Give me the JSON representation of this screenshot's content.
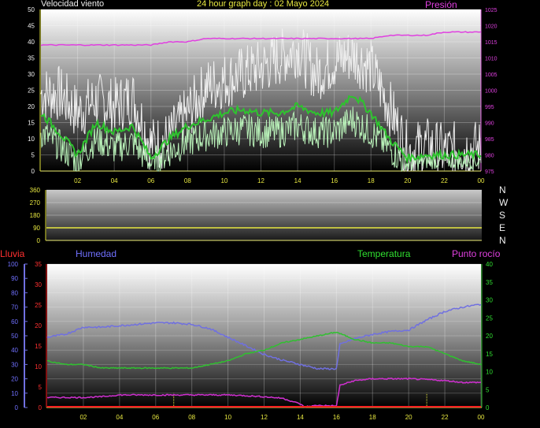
{
  "header": {
    "wind_label": "Velocidad viento",
    "title": "24 hour graph day : 02 Mayo 2024",
    "pressure_label": "Presión"
  },
  "labels": {
    "rain": "Lluvia",
    "humidity": "Humedad",
    "temperature": "Temperatura",
    "dewpoint": "Punto rocío"
  },
  "compass": [
    "N",
    "W",
    "S",
    "E",
    "N"
  ],
  "colors": {
    "wind_gust": "#f0f0f0",
    "wind_avg": "#2ec42e",
    "wind_speed": "#b8f0b8",
    "pressure": "#e040e0",
    "direction": "#e8e840",
    "humidity": "#7070e0",
    "temperature": "#30c030",
    "dewpoint": "#d030d0",
    "rain": "#ff2020",
    "axis_tick": "#e8e840",
    "title": "#e8e840",
    "humidity_label": "#7070ff",
    "temp_label": "#30e030",
    "rain_label": "#ff3030",
    "pressure_label": "#e040e0"
  },
  "chart_data": [
    {
      "type": "line",
      "name": "wind",
      "x_ticks": [
        "02",
        "04",
        "06",
        "08",
        "10",
        "12",
        "14",
        "16",
        "18",
        "20",
        "22",
        "00"
      ],
      "y_ticks_left": [
        0,
        5,
        10,
        15,
        20,
        25,
        30,
        35,
        40,
        45,
        50
      ],
      "y_ticks_right": [
        975,
        980,
        985,
        990,
        995,
        1000,
        1005,
        1010,
        1015,
        1020,
        1025
      ],
      "ylim_left": [
        0,
        50
      ],
      "ylim_right": [
        975,
        1025
      ],
      "xlim_hours": [
        0,
        24
      ],
      "series": [
        {
          "name": "Velocidad viento",
          "role": "gust",
          "x": [
            0,
            1,
            2,
            3,
            4,
            5,
            6,
            7,
            8,
            9,
            10,
            11,
            12,
            13,
            14,
            15,
            16,
            17,
            18,
            19,
            20,
            21,
            22,
            23,
            24
          ],
          "values": [
            24,
            24,
            18,
            22,
            20,
            23,
            8,
            10,
            18,
            26,
            28,
            30,
            32,
            35,
            38,
            30,
            34,
            36,
            32,
            20,
            6,
            8,
            6,
            7,
            7
          ]
        },
        {
          "name": "Velocidad viento",
          "role": "average",
          "x": [
            0,
            1,
            2,
            3,
            4,
            5,
            6,
            7,
            8,
            9,
            10,
            11,
            12,
            13,
            14,
            15,
            16,
            17,
            18,
            19,
            20,
            21,
            22,
            23,
            24
          ],
          "values": [
            18,
            12,
            5,
            15,
            12,
            14,
            4,
            10,
            14,
            16,
            18,
            19,
            18,
            18,
            20,
            18,
            18,
            24,
            18,
            10,
            4,
            5,
            5,
            5,
            5
          ]
        },
        {
          "name": "Velocidad viento",
          "role": "speed",
          "x": [
            0,
            1,
            2,
            3,
            4,
            5,
            6,
            7,
            8,
            9,
            10,
            11,
            12,
            13,
            14,
            15,
            16,
            17,
            18,
            19,
            20,
            21,
            22,
            23,
            24
          ],
          "values": [
            12,
            8,
            3,
            10,
            7,
            9,
            2,
            6,
            9,
            11,
            12,
            13,
            12,
            12,
            14,
            12,
            12,
            16,
            12,
            7,
            2,
            3,
            3,
            3,
            3
          ]
        },
        {
          "name": "Presión",
          "axis": "right",
          "x": [
            0,
            1,
            2,
            3,
            4,
            5,
            6,
            7,
            8,
            9,
            10,
            11,
            12,
            13,
            14,
            15,
            16,
            17,
            18,
            19,
            20,
            21,
            22,
            23,
            24
          ],
          "values": [
            1014,
            1014,
            1014,
            1014,
            1014,
            1014,
            1014,
            1015,
            1015,
            1016,
            1016,
            1016,
            1016,
            1016,
            1016,
            1016,
            1016,
            1016,
            1016,
            1017,
            1017,
            1017,
            1018,
            1018,
            1018
          ]
        }
      ]
    },
    {
      "type": "line",
      "name": "wind-direction",
      "y_ticks": [
        0,
        90,
        180,
        270,
        360
      ],
      "ylim": [
        0,
        360
      ],
      "xlim_hours": [
        0,
        24
      ],
      "series": [
        {
          "role": "direction",
          "x": [
            0,
            24
          ],
          "values": [
            90,
            90
          ]
        }
      ]
    },
    {
      "type": "line",
      "name": "humidity-temp",
      "x_ticks": [
        "02",
        "04",
        "06",
        "08",
        "10",
        "12",
        "14",
        "16",
        "18",
        "20",
        "22",
        "00"
      ],
      "y_ticks_humidity": [
        0,
        10,
        20,
        30,
        40,
        50,
        60,
        70,
        80,
        90,
        100
      ],
      "y_ticks_rain": [
        0,
        5,
        10,
        15,
        20,
        25,
        30,
        35
      ],
      "y_ticks_temp": [
        0,
        5,
        10,
        15,
        20,
        25,
        30,
        35,
        40
      ],
      "ylim_humidity": [
        0,
        100
      ],
      "ylim_rain": [
        0,
        35
      ],
      "ylim_temp": [
        0,
        40
      ],
      "xlim_hours": [
        0,
        24
      ],
      "series": [
        {
          "name": "Humedad",
          "axis": "humidity",
          "x": [
            0,
            1,
            2,
            3,
            4,
            5,
            6,
            7,
            8,
            9,
            10,
            11,
            12,
            13,
            14,
            15,
            16,
            16.2,
            17,
            18,
            19,
            20,
            21,
            22,
            23,
            24
          ],
          "values": [
            49,
            51,
            56,
            56,
            57,
            58,
            59,
            59,
            58,
            55,
            49,
            43,
            37,
            33,
            30,
            27,
            27,
            44,
            48,
            51,
            53,
            54,
            61,
            67,
            70,
            72
          ]
        },
        {
          "name": "Temperatura",
          "axis": "temp",
          "x": [
            0,
            1,
            2,
            3,
            4,
            5,
            6,
            7,
            8,
            9,
            10,
            11,
            12,
            13,
            14,
            15,
            16,
            17,
            18,
            19,
            20,
            21,
            22,
            23,
            24
          ],
          "values": [
            13,
            12,
            12,
            11,
            11,
            11,
            11,
            11,
            11,
            12,
            13,
            15,
            16,
            18,
            19,
            20,
            21,
            19,
            18,
            18,
            17,
            17,
            15,
            13,
            12
          ]
        },
        {
          "name": "Punto rocío",
          "axis": "temp",
          "x": [
            0,
            1,
            2,
            3,
            4,
            5,
            6,
            7,
            8,
            9,
            10,
            11,
            12,
            13,
            14,
            14.2,
            15,
            16,
            16.2,
            17,
            18,
            19,
            20,
            21,
            22,
            23,
            24
          ],
          "values": [
            2.8,
            2.8,
            2.8,
            3,
            3.5,
            3.5,
            3.5,
            3.5,
            3.5,
            3.5,
            3.5,
            3.3,
            3,
            2.6,
            1,
            0.2,
            0.6,
            0.4,
            6.2,
            7.5,
            8,
            8,
            8,
            7.8,
            7.5,
            7,
            7
          ]
        },
        {
          "name": "Lluvia",
          "axis": "rain",
          "x": [
            0,
            24
          ],
          "values": [
            0,
            0
          ]
        }
      ]
    }
  ]
}
